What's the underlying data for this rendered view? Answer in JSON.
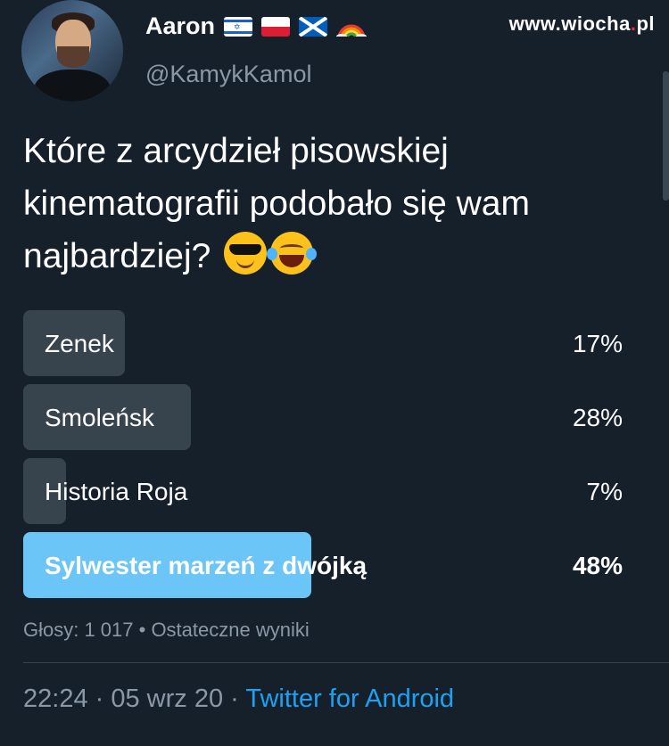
{
  "user": {
    "name": "Aaron",
    "handle": "@KamykKamol",
    "flags": [
      "israel-flag",
      "poland-flag",
      "scotland-flag",
      "rainbow-emoji"
    ]
  },
  "watermark": {
    "prefix": "www.wiocha",
    "dot": ".",
    "suffix": "pl"
  },
  "tweet": {
    "text": "Które z arcydzieł pisowskiej kinematografii podobało się wam najbardziej?",
    "emojis": [
      "smiling-face-with-sunglasses-emoji",
      "face-with-tears-of-joy-emoji"
    ]
  },
  "poll": {
    "options": [
      {
        "label": "Zenek",
        "percent_text": "17%",
        "percent": 17
      },
      {
        "label": "Smoleńsk",
        "percent_text": "28%",
        "percent": 28
      },
      {
        "label": "Historia Roja",
        "percent_text": "7%",
        "percent": 7
      },
      {
        "label": "Sylwester marzeń z dwójką",
        "percent_text": "48%",
        "percent": 48,
        "winner": true
      }
    ],
    "meta": "Głosy: 1 017 • Ostateczne wyniki"
  },
  "footer": {
    "time": "22:24",
    "sep1": " · ",
    "date": "05 wrz 20",
    "sep2": " · ",
    "source": "Twitter for Android"
  },
  "colors": {
    "background": "#15202b",
    "bar": "#38444d",
    "winner_bar": "#6cc5f7",
    "link": "#1da1f2",
    "muted": "#8b98a5"
  }
}
